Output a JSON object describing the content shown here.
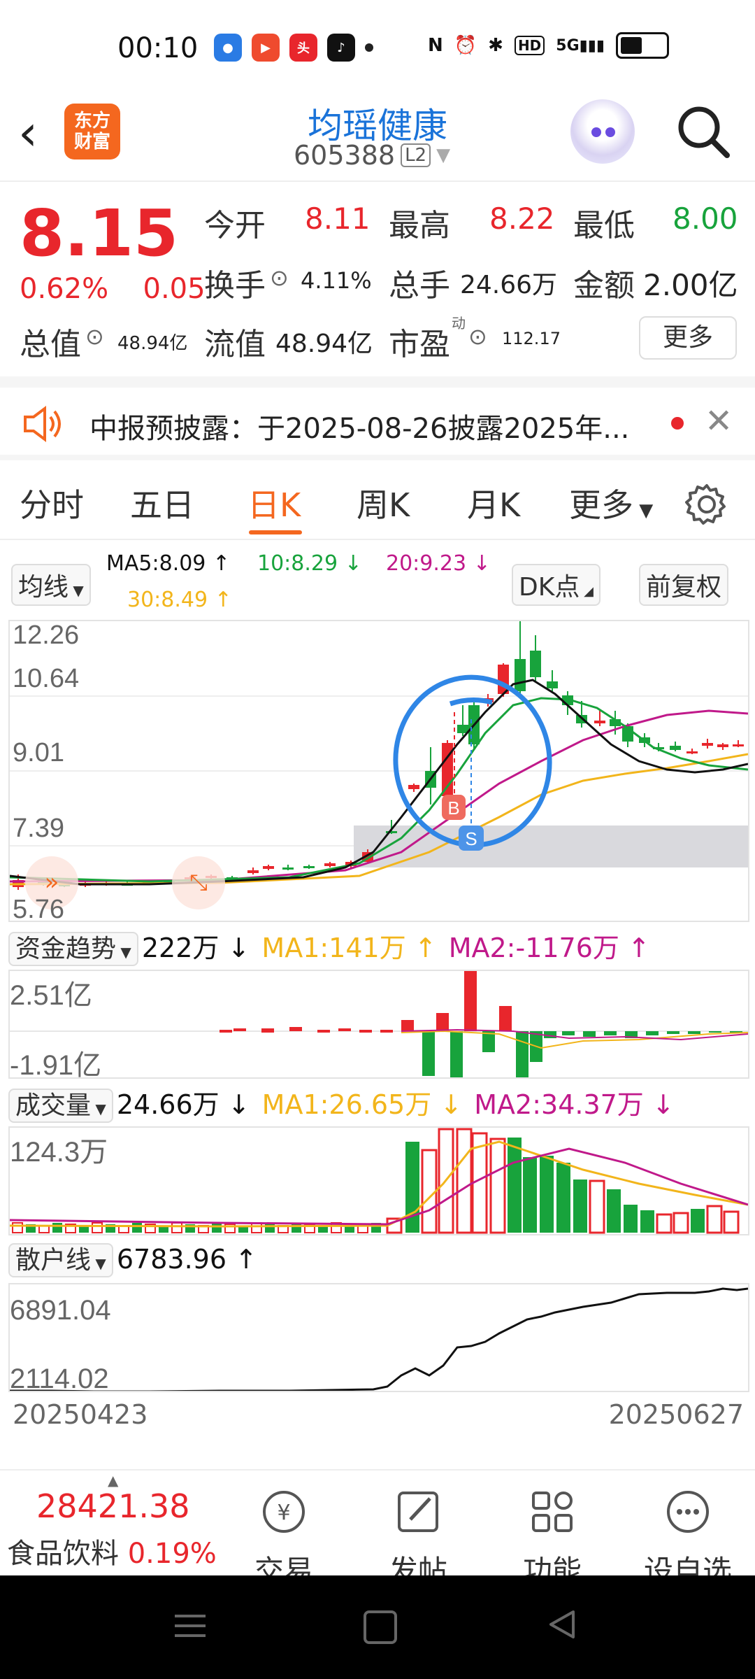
{
  "status": {
    "time": "00:10",
    "network": "5G",
    "hd": "HD"
  },
  "header": {
    "back_icon": "chevron-left-icon",
    "logo_line1": "东方",
    "logo_line2": "财富",
    "stock_name": "均瑶健康",
    "stock_code": "605388",
    "level_badge": "L2"
  },
  "quote": {
    "price": "8.15",
    "change_pct": "0.62%",
    "change_amt": "0.05",
    "open_label": "今开",
    "open": "8.11",
    "high_label": "最高",
    "high": "8.22",
    "low_label": "最低",
    "low": "8.00",
    "turnover_label": "换手",
    "turnover": "4.11%",
    "volume_label": "总手",
    "volume": "24.66万",
    "amount_label": "金额",
    "amount": "2.00亿",
    "total_value_label": "总值",
    "total_value": "48.94亿",
    "float_value_label": "流值",
    "float_value": "48.94亿",
    "pe_label": "市盈",
    "pe_sup": "动",
    "pe": "112.17",
    "more_label": "更多"
  },
  "notice": {
    "text": "中报预披露：于2025-08-26披露2025年..."
  },
  "tabs": [
    {
      "label": "分时"
    },
    {
      "label": "五日"
    },
    {
      "label": "日K"
    },
    {
      "label": "周K"
    },
    {
      "label": "月K"
    },
    {
      "label": "更多"
    }
  ],
  "ma": {
    "selector": "均线",
    "ma5": "MA5:8.09",
    "ma10": "10:8.29",
    "ma20": "20:9.23",
    "ma30": "30:8.49",
    "dk_label": "DK点",
    "adjust_label": "前复权",
    "colors": {
      "ma5": "#111111",
      "ma10": "#18a33c",
      "ma20": "#c0198a",
      "ma30": "#f2b51b"
    }
  },
  "main_chart": {
    "y_labels": [
      "12.26",
      "10.64",
      "9.01",
      "7.39",
      "5.76"
    ],
    "buy_marker": "B",
    "sell_marker": "S"
  },
  "fund_trend": {
    "selector": "资金趋势",
    "value": "222万",
    "ma1": "MA1:141万",
    "ma2": "MA2:-1176万",
    "y_top": "2.51亿",
    "y_bottom": "-1.91亿"
  },
  "volume_panel": {
    "selector": "成交量",
    "value": "24.66万",
    "ma1": "MA1:26.65万",
    "ma2": "MA2:34.37万",
    "y_top": "124.3万"
  },
  "retail_line": {
    "selector": "散户线",
    "value": "6783.96",
    "y_top": "6891.04",
    "y_bottom": "2114.02"
  },
  "date_range": {
    "start": "20250423",
    "end": "20250627"
  },
  "index_info": {
    "value": "28421.38",
    "name": "食品饮料",
    "pct": "0.19%"
  },
  "bottom_nav": [
    {
      "label": "交易",
      "icon": "yen-exchange-icon"
    },
    {
      "label": "发帖",
      "icon": "edit-icon"
    },
    {
      "label": "功能",
      "icon": "grid-icon"
    },
    {
      "label": "设自选",
      "icon": "more-dots-icon"
    }
  ]
}
